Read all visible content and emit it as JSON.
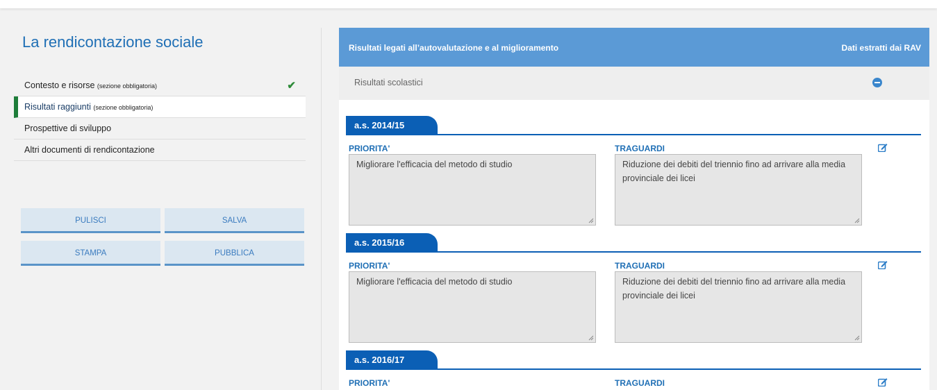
{
  "sidebar": {
    "title": "La rendicontazione sociale",
    "items": [
      {
        "label": "Contesto e risorse",
        "note": "(sezione obbligatoria)",
        "done": true
      },
      {
        "label": "Risultati raggiunti",
        "note": "(sezione obbligatoria)",
        "active": true
      },
      {
        "label": "Prospettive di sviluppo",
        "note": ""
      },
      {
        "label": "Altri documenti di rendicontazione",
        "note": ""
      }
    ],
    "buttons": {
      "pulisci": "PULISCI",
      "salva": "SALVA",
      "stampa": "STAMPA",
      "pubblica": "PUBBLICA"
    },
    "check_icon": "check-icon"
  },
  "main": {
    "header_left": "Risultati legati all’autovalutazione e al miglioramento",
    "header_right": "Dati estratti dai RAV",
    "section_label": "Risultati scolastici",
    "years": [
      {
        "label": "a.s. 2014/15",
        "priorita_label": "PRIORITA'",
        "traguardi_label": "TRAGUARDI",
        "priorita": "Migliorare l'efficacia del metodo di studio",
        "traguardi": "Riduzione dei debiti del triennio fino ad arrivare alla media provinciale dei licei"
      },
      {
        "label": "a.s. 2015/16",
        "priorita_label": "PRIORITA'",
        "traguardi_label": "TRAGUARDI",
        "priorita": "Migliorare l'efficacia del metodo di studio",
        "traguardi": "Riduzione dei debiti del triennio fino ad arrivare alla media provinciale dei licei"
      },
      {
        "label": "a.s. 2016/17",
        "priorita_label": "PRIORITA'",
        "traguardi_label": "TRAGUARDI",
        "priorita": "",
        "traguardi": ""
      }
    ]
  },
  "colors": {
    "accent": "#1f6fb5",
    "header": "#5b9ad6",
    "tab": "#0b5fb5",
    "active_marker": "#1e7d3a"
  }
}
